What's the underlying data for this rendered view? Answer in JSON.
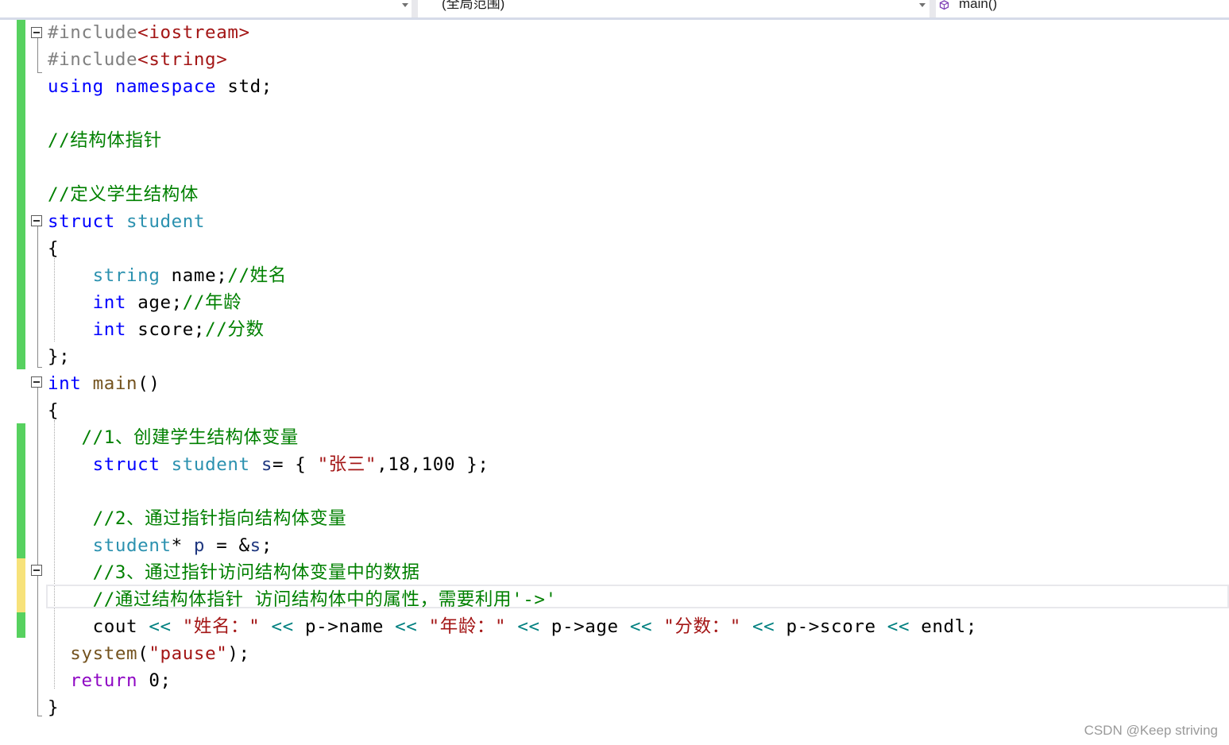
{
  "navbar": {
    "scope": "(全局范围)",
    "function": "main()"
  },
  "code_lines": [
    [
      [
        "t-pp",
        "#include"
      ],
      [
        "t-inc",
        "<iostream>"
      ]
    ],
    [
      [
        "t-pp",
        "#include"
      ],
      [
        "t-inc",
        "<string>"
      ]
    ],
    [
      [
        "t-kw",
        "using"
      ],
      [
        "t-pl",
        " "
      ],
      [
        "t-kw",
        "namespace"
      ],
      [
        "t-pl",
        " std;"
      ]
    ],
    [],
    [
      [
        "t-cm",
        "//结构体指针"
      ]
    ],
    [],
    [
      [
        "t-cm",
        "//定义学生结构体"
      ]
    ],
    [
      [
        "t-kw",
        "struct"
      ],
      [
        "t-pl",
        " "
      ],
      [
        "t-ty",
        "student"
      ]
    ],
    [
      [
        "t-pl",
        "{"
      ]
    ],
    [
      [
        "t-pl",
        "    "
      ],
      [
        "t-ty",
        "string"
      ],
      [
        "t-pl",
        " name;"
      ],
      [
        "t-cm",
        "//姓名"
      ]
    ],
    [
      [
        "t-pl",
        "    "
      ],
      [
        "t-kw",
        "int"
      ],
      [
        "t-pl",
        " age;"
      ],
      [
        "t-cm",
        "//年龄"
      ]
    ],
    [
      [
        "t-pl",
        "    "
      ],
      [
        "t-kw",
        "int"
      ],
      [
        "t-pl",
        " score;"
      ],
      [
        "t-cm",
        "//分数"
      ]
    ],
    [
      [
        "t-pl",
        "};"
      ]
    ],
    [
      [
        "t-kw",
        "int"
      ],
      [
        "t-pl",
        " "
      ],
      [
        "t-fn",
        "main"
      ],
      [
        "t-pl",
        "()"
      ]
    ],
    [
      [
        "t-pl",
        "{"
      ]
    ],
    [
      [
        "t-pl",
        "   "
      ],
      [
        "t-cm",
        "//1、创建学生结构体变量"
      ]
    ],
    [
      [
        "t-pl",
        "    "
      ],
      [
        "t-kw",
        "struct"
      ],
      [
        "t-pl",
        " "
      ],
      [
        "t-ty",
        "student"
      ],
      [
        "t-pl",
        " "
      ],
      [
        "t-var",
        "s"
      ],
      [
        "t-pl",
        "= { "
      ],
      [
        "t-str",
        "\"张三\""
      ],
      [
        "t-pl",
        ",18,100 };"
      ]
    ],
    [],
    [
      [
        "t-pl",
        "    "
      ],
      [
        "t-cm",
        "//2、通过指针指向结构体变量"
      ]
    ],
    [
      [
        "t-pl",
        "    "
      ],
      [
        "t-ty",
        "student"
      ],
      [
        "t-pl",
        "* "
      ],
      [
        "t-var",
        "p"
      ],
      [
        "t-pl",
        " = &"
      ],
      [
        "t-var",
        "s"
      ],
      [
        "t-pl",
        ";"
      ]
    ],
    [
      [
        "t-pl",
        "    "
      ],
      [
        "t-cm",
        "//3、通过指针访问结构体变量中的数据"
      ]
    ],
    [
      [
        "t-pl",
        "    "
      ],
      [
        "t-cm",
        "//通过结构体指针 访问结构体中的属性，需要利用'->'"
      ]
    ],
    [
      [
        "t-pl",
        "    cout "
      ],
      [
        "t-op",
        "<<"
      ],
      [
        "t-pl",
        " "
      ],
      [
        "t-str",
        "\"姓名：\""
      ],
      [
        "t-pl",
        " "
      ],
      [
        "t-op",
        "<<"
      ],
      [
        "t-pl",
        " p->name "
      ],
      [
        "t-op",
        "<<"
      ],
      [
        "t-pl",
        " "
      ],
      [
        "t-str",
        "\"年龄：\""
      ],
      [
        "t-pl",
        " "
      ],
      [
        "t-op",
        "<<"
      ],
      [
        "t-pl",
        " p->age "
      ],
      [
        "t-op",
        "<<"
      ],
      [
        "t-pl",
        " "
      ],
      [
        "t-str",
        "\"分数：\""
      ],
      [
        "t-pl",
        " "
      ],
      [
        "t-op",
        "<<"
      ],
      [
        "t-pl",
        " p->score "
      ],
      [
        "t-op",
        "<<"
      ],
      [
        "t-pl",
        " endl;"
      ]
    ],
    [
      [
        "t-pl",
        "  "
      ],
      [
        "t-fn",
        "system"
      ],
      [
        "t-pl",
        "("
      ],
      [
        "t-str",
        "\"pause\""
      ],
      [
        "t-pl",
        ");"
      ]
    ],
    [
      [
        "t-pl",
        "  "
      ],
      [
        "t-ret",
        "return"
      ],
      [
        "t-pl",
        " 0;"
      ]
    ],
    [
      [
        "t-pl",
        "}"
      ]
    ]
  ],
  "watermark": "CSDN @Keep striving"
}
